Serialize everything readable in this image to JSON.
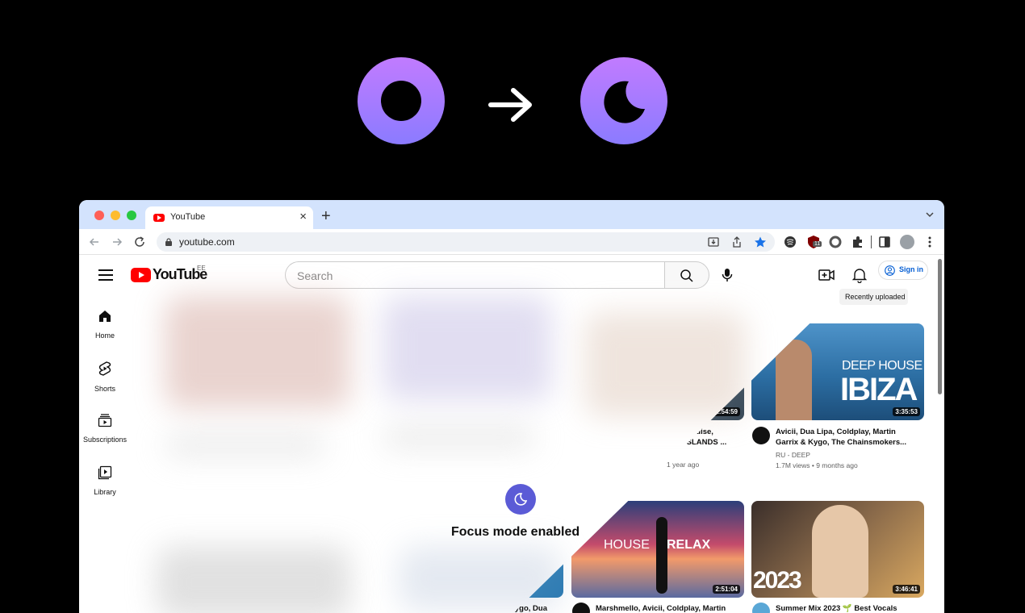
{
  "browser": {
    "tab_title": "YouTube",
    "url": "youtube.com",
    "extension_badge": "11"
  },
  "youtube": {
    "logo_text": "YouTube",
    "country_code": "EE",
    "search_placeholder": "Search",
    "sign_in": "Sign in",
    "tooltip": "Recently uploaded",
    "sidebar": [
      {
        "label": "Home",
        "icon": "home-icon"
      },
      {
        "label": "Shorts",
        "icon": "shorts-icon"
      },
      {
        "label": "Subscriptions",
        "icon": "subscriptions-icon"
      },
      {
        "label": "Library",
        "icon": "library-icon"
      }
    ],
    "focus_message": "Focus mode enabled",
    "videos": [
      {
        "duration": "1:54:59",
        "title_line1": "aradise,",
        "title_line2": "ISLANDS ...",
        "meta": "1 year ago"
      },
      {
        "thumb_text_1": "DEEP HOUSE",
        "thumb_text_2": "IBIZA",
        "duration": "3:35:53",
        "title_line1": "Avicii, Dua Lipa, Coldplay, Martin",
        "title_line2": "Garrix & Kygo, The Chainsmokers...",
        "channel": "RU - DEEP",
        "meta": "1.7M views • 9 months ago"
      },
      {
        "thumb_text_1": "HOUSE",
        "thumb_text_2": "RELAX",
        "duration": "2:51:04",
        "title_line1": "Marshmello, Avicii, Coldplay, Martin"
      },
      {
        "thumb_text_1": "2023",
        "duration": "3:46:41",
        "title_line1": "Summer Mix 2023 🌱 Best Vocals"
      },
      {
        "title_line1": "Kygo, Dua"
      }
    ]
  },
  "colors": {
    "accent_purple": "#a97bff",
    "focus_icon": "#5b5bd6",
    "youtube_red": "#ff0000",
    "link_blue": "#065fd4"
  }
}
